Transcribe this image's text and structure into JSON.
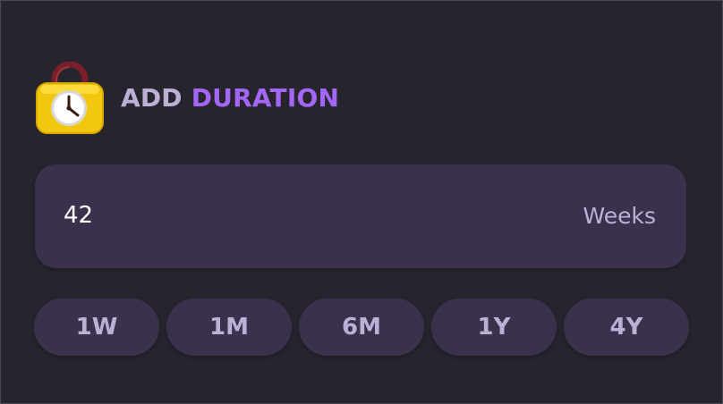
{
  "header": {
    "icon": "clock-lock-icon",
    "title_part1": "ADD",
    "title_part2": "DURATION"
  },
  "duration_input": {
    "value": "42",
    "unit": "Weeks"
  },
  "presets": [
    {
      "label": "1W"
    },
    {
      "label": "1M"
    },
    {
      "label": "6M"
    },
    {
      "label": "1Y"
    },
    {
      "label": "4Y"
    }
  ],
  "colors": {
    "background": "#26252e",
    "card": "#3b314d",
    "accent": "#a466f5",
    "muted_text": "#bcb0d6"
  }
}
